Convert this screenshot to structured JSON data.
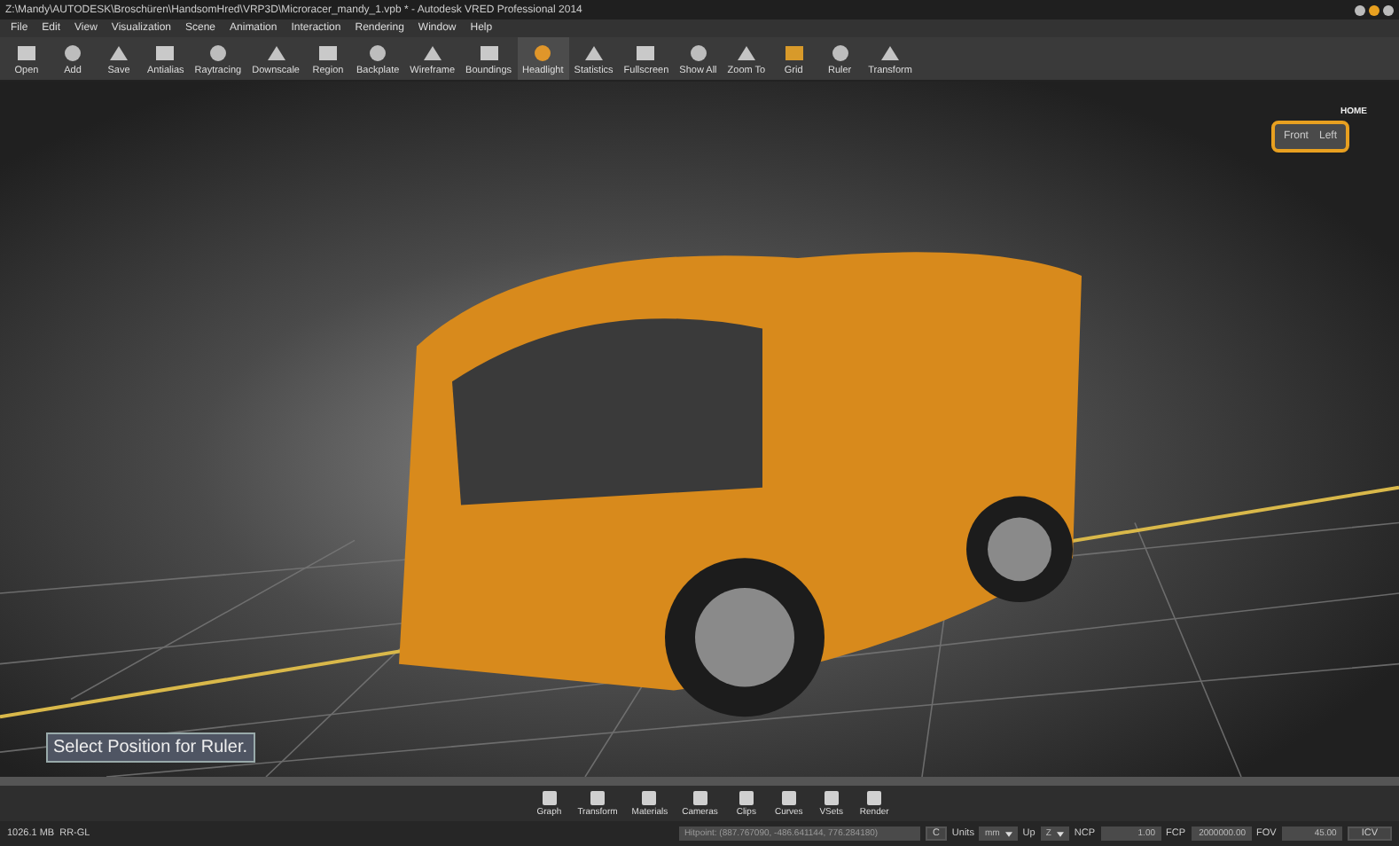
{
  "window": {
    "title": "Z:\\Mandy\\AUTODESK\\Broschüren\\HandsomHred\\VRP3D\\Microracer_mandy_1.vpb * - Autodesk VRED Professional 2014"
  },
  "menu": [
    "File",
    "Edit",
    "View",
    "Visualization",
    "Scene",
    "Animation",
    "Interaction",
    "Rendering",
    "Window",
    "Help"
  ],
  "toolbar": [
    {
      "label": "Open",
      "selected": false
    },
    {
      "label": "Add",
      "selected": false
    },
    {
      "label": "Save",
      "selected": false
    },
    {
      "label": "Antialias",
      "selected": false
    },
    {
      "label": "Raytracing",
      "selected": false
    },
    {
      "label": "Downscale",
      "selected": false
    },
    {
      "label": "Region",
      "selected": false
    },
    {
      "label": "Backplate",
      "selected": false
    },
    {
      "label": "Wireframe",
      "selected": false
    },
    {
      "label": "Boundings",
      "selected": false
    },
    {
      "label": "Headlight",
      "selected": true
    },
    {
      "label": "Statistics",
      "selected": false
    },
    {
      "label": "Fullscreen",
      "selected": false
    },
    {
      "label": "Show All",
      "selected": false
    },
    {
      "label": "Zoom To",
      "selected": false
    },
    {
      "label": "Grid",
      "selected": false
    },
    {
      "label": "Ruler",
      "selected": false
    },
    {
      "label": "Transform",
      "selected": false
    }
  ],
  "viewport": {
    "hint": "Select Position for Ruler.",
    "nav_cube": {
      "home": "HOME",
      "faces": [
        "Front",
        "Left"
      ]
    }
  },
  "dock": [
    "Graph",
    "Transform",
    "Materials",
    "Cameras",
    "Clips",
    "Curves",
    "VSets",
    "Render"
  ],
  "status_bar": {
    "memory": "1026.1 MB",
    "renderer": "RR-GL",
    "hitpoint": "Hitpoint: (887.767090, -486.641144, 776.284180)",
    "c_button": "C",
    "units_label": "Units",
    "units": "mm",
    "up_label": "Up",
    "up": "Z",
    "ncp_label": "NCP",
    "ncp": "1.00",
    "fcp_label": "FCP",
    "fcp": "2000000.00",
    "fov_label": "FOV",
    "fov": "45.00",
    "icv_button": "ICV"
  }
}
